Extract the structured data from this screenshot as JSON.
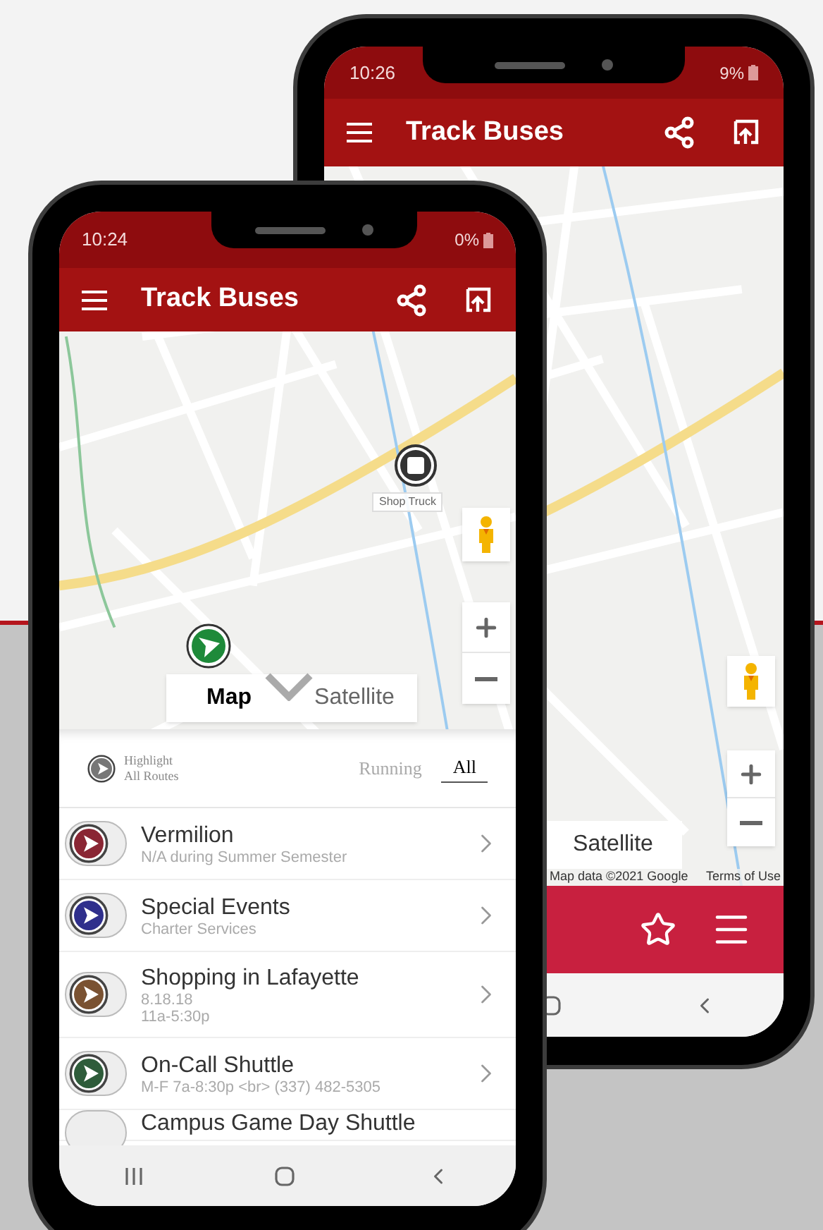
{
  "back_phone": {
    "status_bar": {
      "time": "10:26",
      "battery": "9%"
    },
    "app_bar": {
      "title": "Track Buses"
    },
    "map": {
      "map_type_button": "Satellite",
      "attribution": "Map data ©2021 Google",
      "terms_link": "Terms of Use"
    }
  },
  "front_phone": {
    "status_bar": {
      "time": "10:24",
      "battery": "0%"
    },
    "app_bar": {
      "title": "Track Buses"
    },
    "map": {
      "marker_label": "Shop Truck",
      "map_types": [
        {
          "label": "Map",
          "selected": true
        },
        {
          "label": "Satellite",
          "selected": false
        }
      ]
    },
    "filter": {
      "highlight_label": "Highlight",
      "highlight_sublabel": "All Routes",
      "tabs": [
        {
          "label": "Running",
          "selected": false
        },
        {
          "label": "All",
          "selected": true
        }
      ]
    },
    "routes": [
      {
        "name": "Vermilion",
        "details": [
          "N/A during Summer Semester"
        ],
        "color": "#8a2634"
      },
      {
        "name": "Special Events",
        "details": [
          "Charter Services"
        ],
        "color": "#2f2f8c"
      },
      {
        "name": "Shopping in Lafayette",
        "details": [
          "8.18.18",
          "11a-5:30p"
        ],
        "color": "#7a5232"
      },
      {
        "name": "On-Call Shuttle",
        "details": [
          "M-F 7a-8:30p <br> (337) 482-5305"
        ],
        "color": "#2e5c3a"
      },
      {
        "name": "Campus Game Day Shuttle"
      }
    ]
  }
}
